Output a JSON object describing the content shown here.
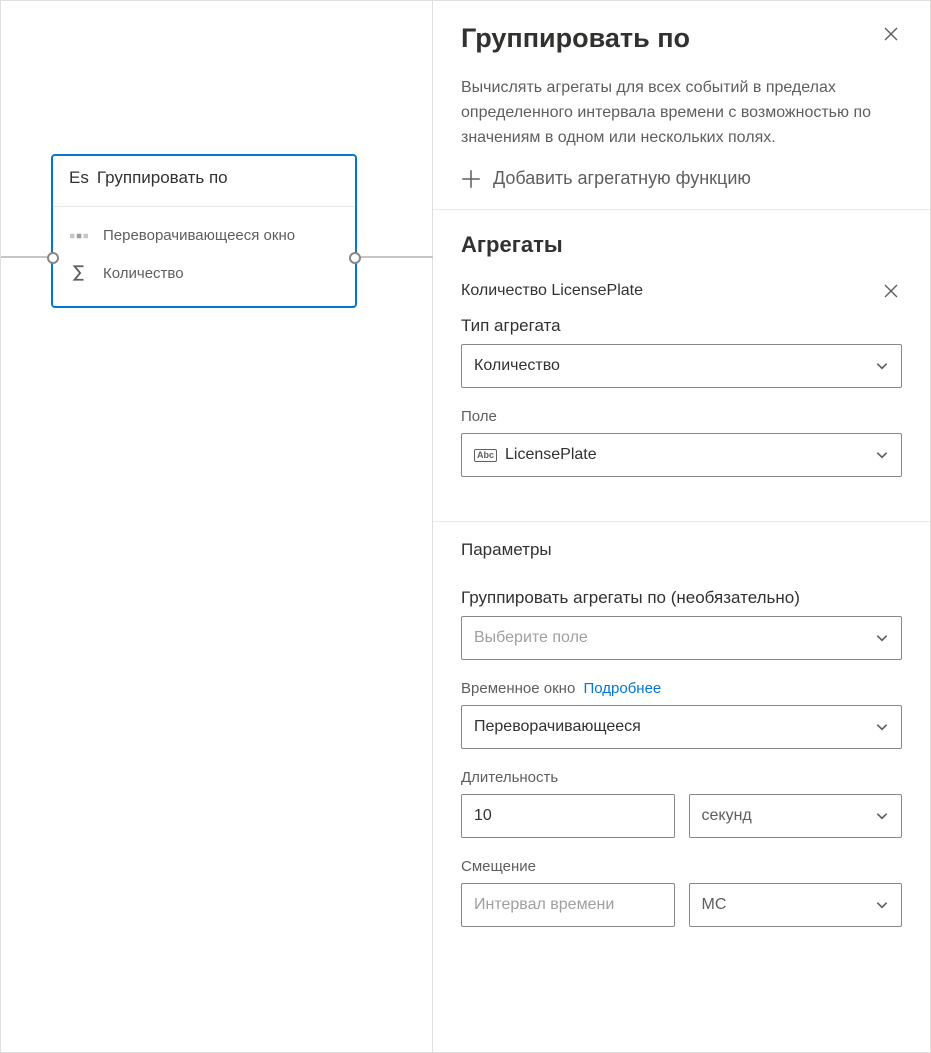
{
  "canvas": {
    "node_prefix": "Es",
    "node_title": "Группировать по",
    "row_window": "Переворачивающееся окно",
    "row_count": "Количество"
  },
  "panel": {
    "title": "Группировать по",
    "description": "Вычислять агрегаты для всех событий в пределах определенного интервала времени с возможностью по значениям в одном или нескольких полях.",
    "add_aggregate": "Добавить агрегатную функцию",
    "aggregates_heading": "Агрегаты",
    "aggregate": {
      "name": "Количество LicensePlate",
      "type_label": "Тип агрегата",
      "type_value": "Количество",
      "field_label": "Поле",
      "field_badge": "Abc",
      "field_value": "LicensePlate"
    },
    "params": {
      "heading": "Параметры",
      "group_by_label": "Группировать агрегаты по (необязательно)",
      "group_by_placeholder": "Выберите поле",
      "time_window_label": "Временное окно",
      "time_window_more": "Подробнее",
      "window_type": "Переворачивающееся",
      "duration_label": "Длительность",
      "duration_value": "10",
      "duration_unit": "секунд",
      "offset_label": "Смещение",
      "offset_placeholder": "Интервал времени",
      "offset_unit": "МС"
    }
  }
}
